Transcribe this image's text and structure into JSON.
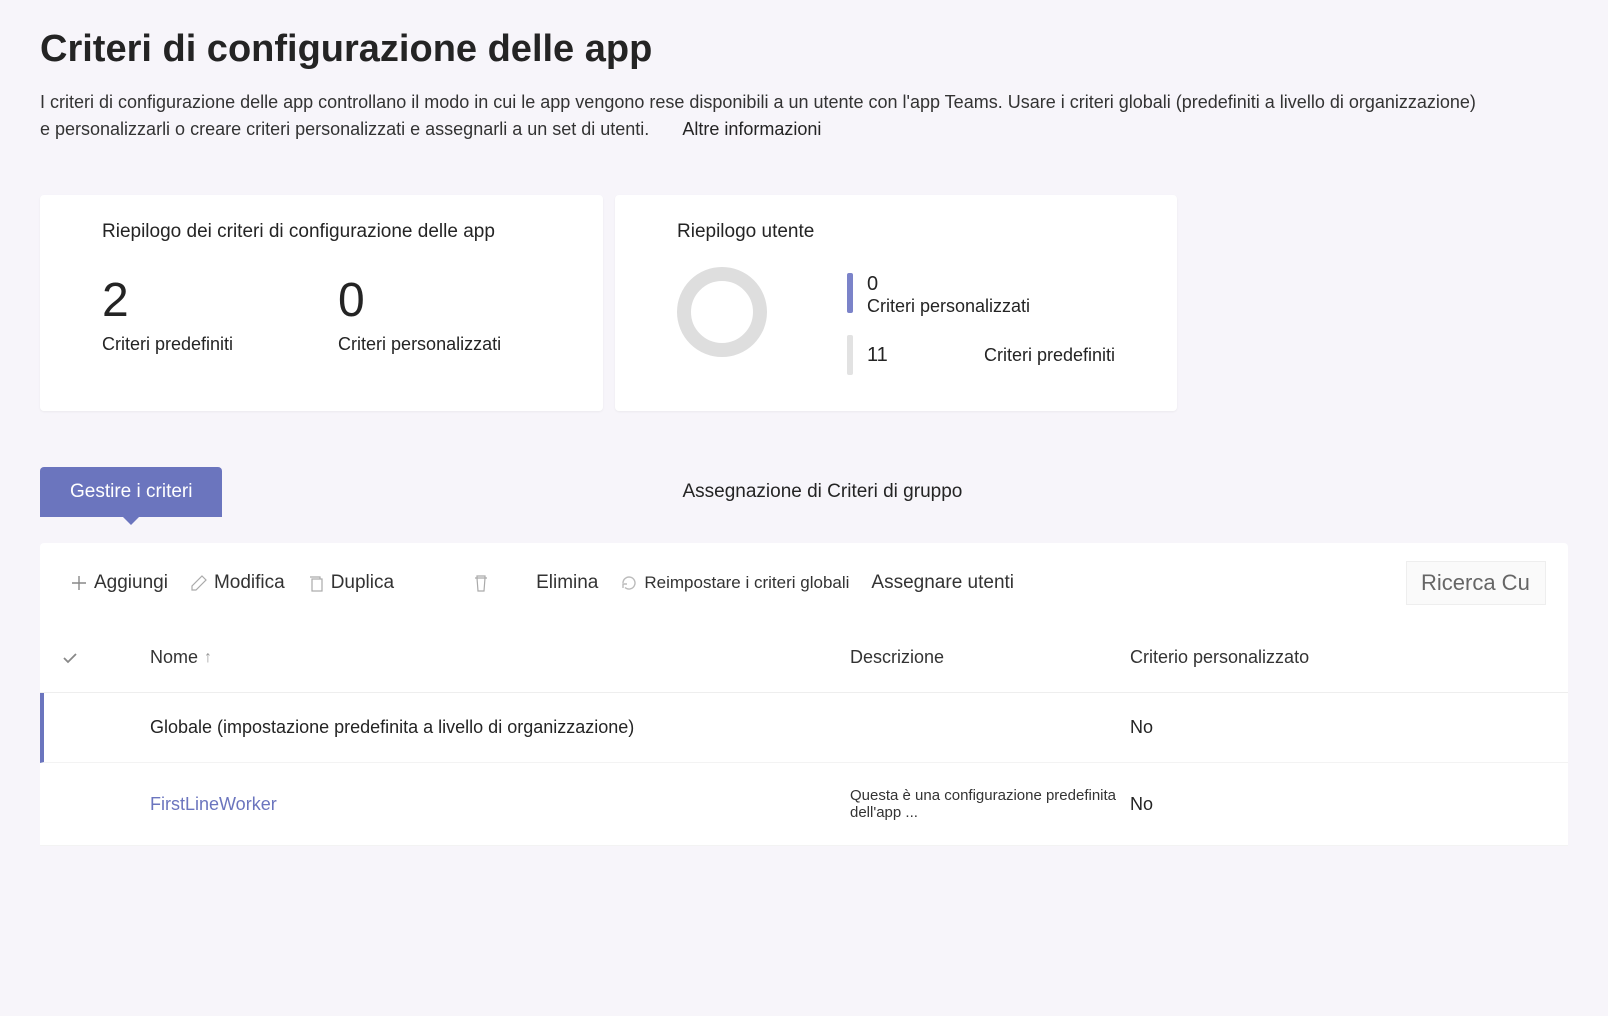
{
  "page": {
    "title": "Criteri di configurazione delle app",
    "description": "I criteri di configurazione delle app controllano il modo in cui le app vengono rese disponibili a un utente con l'app Teams. Usare i criteri globali (predefiniti a livello di organizzazione) e personalizzarli o creare criteri personalizzati e assegnarli a un set di utenti.",
    "more_info": "Altre informazioni"
  },
  "summary": {
    "config_title": "Riepilogo dei criteri di configurazione delle app",
    "predefined_count": "2",
    "predefined_label": "Criteri predefiniti",
    "custom_count": "0",
    "custom_label": "Criteri personalizzati",
    "user_title": "Riepilogo utente",
    "user_custom_count": "0",
    "user_custom_label": "Criteri personalizzati",
    "user_predefined_count": "11",
    "user_predefined_label": "Criteri predefiniti"
  },
  "tabs": {
    "manage": "Gestire i criteri",
    "group_assign": "Assegnazione di Criteri di gruppo"
  },
  "toolbar": {
    "add": "Aggiungi",
    "edit": "Modifica",
    "duplicate": "Duplica",
    "delete": "Elimina",
    "reset": "Reimpostare i criteri globali",
    "assign": "Assegnare utenti",
    "search_placeholder": "Ricerca Cu"
  },
  "table": {
    "col_name": "Nome",
    "col_desc": "Descrizione",
    "col_custom": "Criterio personalizzato",
    "rows": [
      {
        "name": "Globale (impostazione predefinita a livello di organizzazione)",
        "desc": "",
        "custom": "No",
        "selected": true,
        "link": false
      },
      {
        "name": "FirstLineWorker",
        "desc": "Questa è una configurazione predefinita dell'app ...",
        "custom": "No",
        "selected": false,
        "link": true
      }
    ]
  }
}
